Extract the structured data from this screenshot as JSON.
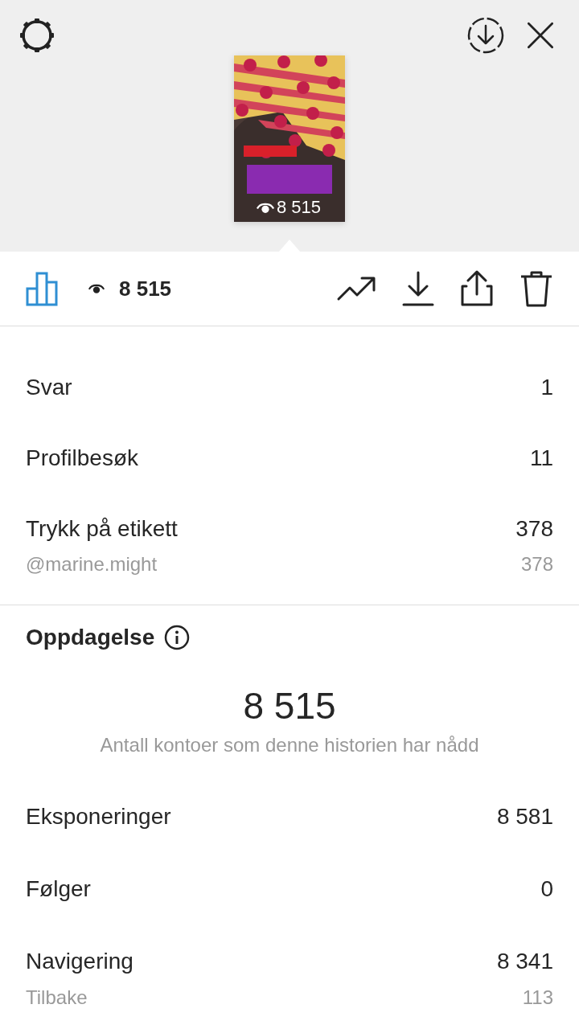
{
  "header": {
    "thumbnail": {
      "views": "8 515"
    }
  },
  "toolbar": {
    "insights_selected": true,
    "views": "8 515"
  },
  "interactions": [
    {
      "kind": "main",
      "label": "Svar",
      "value": "1"
    },
    {
      "kind": "main",
      "label": "Profilbesøk",
      "value": "11"
    },
    {
      "kind": "main",
      "label": "Trykk på etikett",
      "value": "378"
    },
    {
      "kind": "sub",
      "label": "@marine.might",
      "value": "378"
    }
  ],
  "discovery": {
    "title": "Oppdagelse",
    "reach": "8 515",
    "reach_caption": "Antall kontoer som denne historien har nådd",
    "rows": [
      {
        "kind": "main",
        "label": "Eksponeringer",
        "value": "8 581"
      },
      {
        "kind": "main",
        "label": "Følger",
        "value": "0"
      },
      {
        "kind": "main",
        "label": "Navigering",
        "value": "8 341"
      },
      {
        "kind": "sub",
        "label": "Tilbake",
        "value": "113"
      }
    ]
  }
}
